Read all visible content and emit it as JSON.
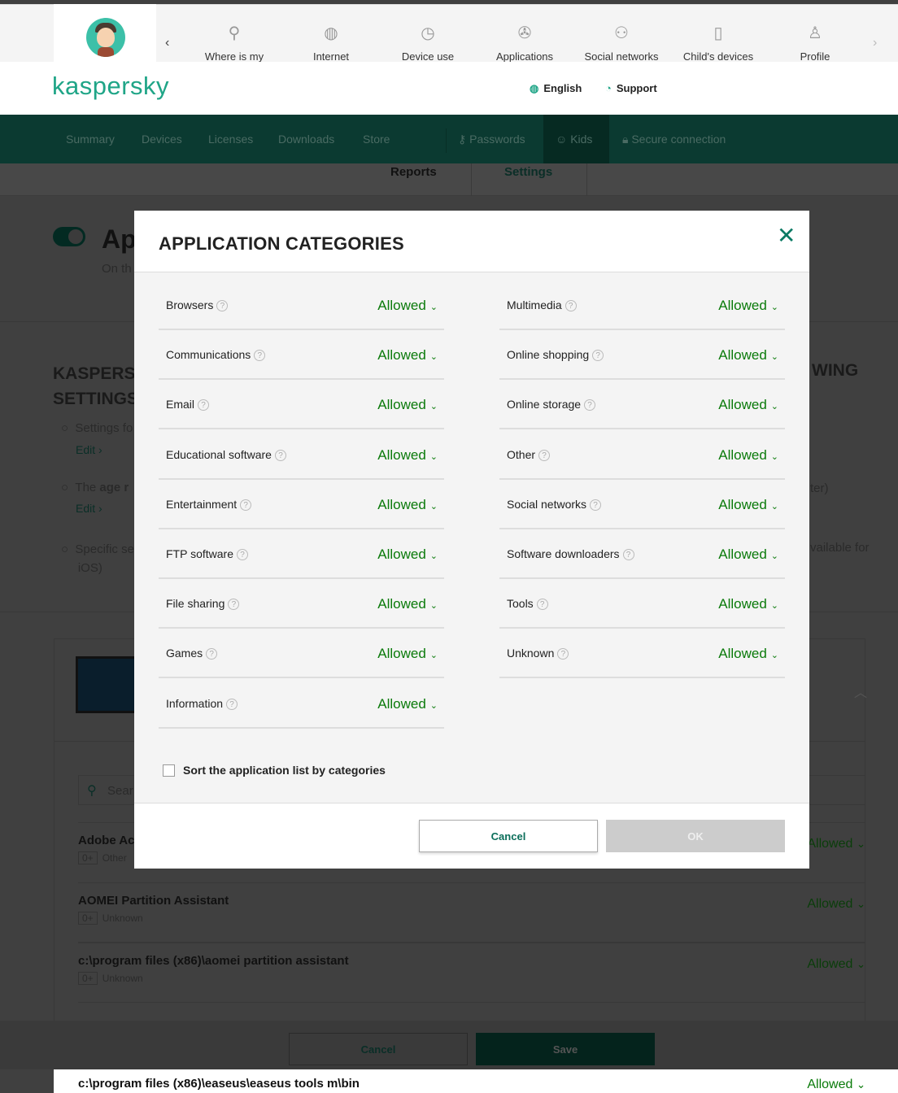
{
  "topnav": {
    "items": [
      {
        "label": "Where is my",
        "icon": "map-pin-icon",
        "glyph": "⚲"
      },
      {
        "label": "Internet",
        "icon": "globe-icon",
        "glyph": "◍"
      },
      {
        "label": "Device use",
        "icon": "clock-icon",
        "glyph": "◷"
      },
      {
        "label": "Applications",
        "icon": "gamepad-icon",
        "glyph": "✇"
      },
      {
        "label": "Social networks",
        "icon": "people-icon",
        "glyph": "⚇"
      },
      {
        "label": "Child's devices",
        "icon": "devices-icon",
        "glyph": "▯"
      },
      {
        "label": "Profile",
        "icon": "user-icon",
        "glyph": "♙"
      }
    ]
  },
  "header": {
    "logo": "kaspersky",
    "language": "English",
    "support": "Support"
  },
  "mainnav": {
    "items": [
      "Summary",
      "Devices",
      "Licenses",
      "Downloads",
      "Store"
    ],
    "passwords": "Passwords",
    "kids": "Kids",
    "secure": "Secure connection"
  },
  "subtabs": {
    "reports": "Reports",
    "settings": "Settings"
  },
  "background": {
    "title": "Ap",
    "subtitle": "On th",
    "section_title_left": "KASPERSK",
    "section_title_left2": "SETTINGS",
    "section_title_right": "WING",
    "bullets": [
      {
        "text": "Settings fo",
        "link": "Edit ›"
      },
      {
        "text_pre": "The ",
        "text_bold": "age r",
        "link": "Edit ›",
        "right": "ter)"
      },
      {
        "text": "Specific se",
        "text2": "iOS)",
        "right": "vailable for"
      }
    ],
    "search_placeholder": "Sear",
    "apps": [
      {
        "name": "Adobe Ac",
        "age": "0+",
        "category": "Other",
        "value": "Allowed"
      },
      {
        "name": "AOMEI Partition Assistant",
        "age": "0+",
        "category": "Unknown",
        "value": "Allowed"
      },
      {
        "name": "c:\\program files (x86)\\aomei partition assistant",
        "age": "0+",
        "category": "Unknown",
        "value": "Allowed"
      },
      {
        "name": "c:\\program files (x86)\\easeus\\easeus tools m\\bin",
        "value": "Allowed"
      }
    ],
    "cancel": "Cancel",
    "save": "Save"
  },
  "modal": {
    "title": "APPLICATION CATEGORIES",
    "left": [
      {
        "label": "Browsers",
        "value": "Allowed"
      },
      {
        "label": "Communications",
        "value": "Allowed"
      },
      {
        "label": "Email",
        "value": "Allowed"
      },
      {
        "label": "Educational software",
        "value": "Allowed"
      },
      {
        "label": "Entertainment",
        "value": "Allowed"
      },
      {
        "label": "FTP software",
        "value": "Allowed"
      },
      {
        "label": "File sharing",
        "value": "Allowed"
      },
      {
        "label": "Games",
        "value": "Allowed"
      },
      {
        "label": "Information",
        "value": "Allowed"
      }
    ],
    "right": [
      {
        "label": "Multimedia",
        "value": "Allowed"
      },
      {
        "label": "Online shopping",
        "value": "Allowed"
      },
      {
        "label": "Online storage",
        "value": "Allowed"
      },
      {
        "label": "Other",
        "value": "Allowed"
      },
      {
        "label": "Social networks",
        "value": "Allowed"
      },
      {
        "label": "Software downloaders",
        "value": "Allowed"
      },
      {
        "label": "Tools",
        "value": "Allowed"
      },
      {
        "label": "Unknown",
        "value": "Allowed"
      }
    ],
    "sort_label": "Sort the application list by categories",
    "sort_checked": false,
    "cancel": "Cancel",
    "ok": "OK"
  },
  "colors": {
    "brand": "#1fa587",
    "allowed": "#0a7a0a"
  }
}
